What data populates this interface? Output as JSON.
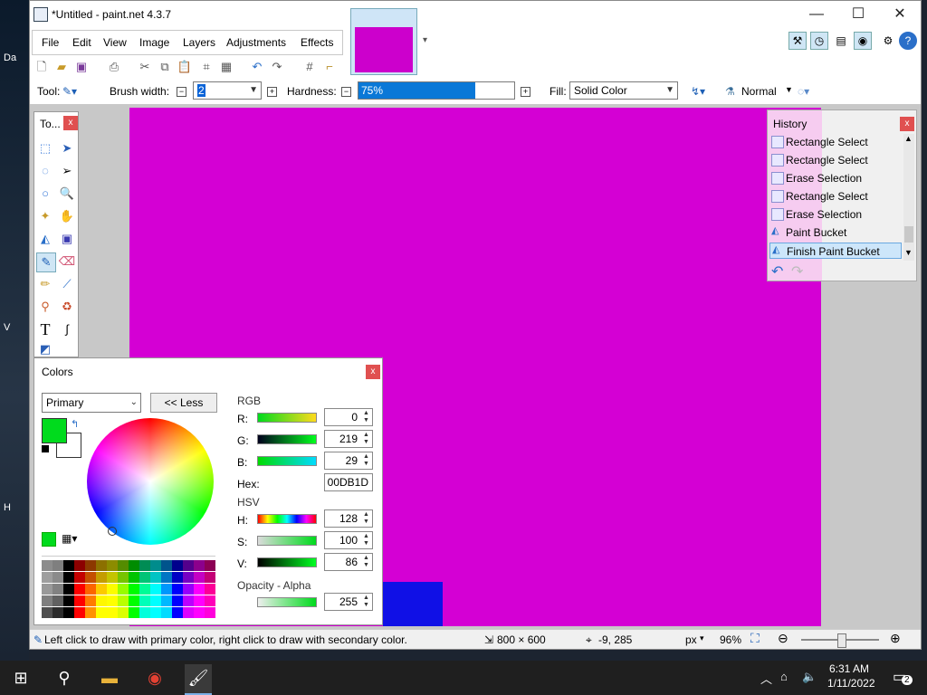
{
  "desktop": {
    "labels": [
      "Da",
      "V",
      "H"
    ]
  },
  "window": {
    "title": "*Untitled - paint.net 4.3.7",
    "controls": {
      "minimize": "—",
      "maximize": "☐",
      "close": "✕"
    }
  },
  "menu": [
    "File",
    "Edit",
    "View",
    "Image",
    "Layers",
    "Adjustments",
    "Effects"
  ],
  "tool_options": {
    "tool_label": "Tool:",
    "brush_width_label": "Brush width:",
    "brush_width_value": "2",
    "hardness_label": "Hardness:",
    "hardness_value": "75%",
    "hardness_fraction": 0.75,
    "fill_label": "Fill:",
    "fill_value": "Solid Color",
    "blend_value": "Normal"
  },
  "tools_panel": {
    "title": "To...",
    "close": "x"
  },
  "history": {
    "title": "History",
    "close": "x",
    "items": [
      "Rectangle Select",
      "Rectangle Select",
      "Erase Selection",
      "Rectangle Select",
      "Erase Selection",
      "Paint Bucket",
      "Finish Paint Bucket"
    ],
    "selected_index": 6
  },
  "colors": {
    "title": "Colors",
    "close": "x",
    "mode": "Primary",
    "less_button": "<< Less",
    "rgb_label": "RGB",
    "hsv_label": "HSV",
    "r_label": "R:",
    "r_value": "0",
    "g_label": "G:",
    "g_value": "219",
    "b_label": "B:",
    "b_value": "29",
    "hex_label": "Hex:",
    "hex_value": "00DB1D",
    "h_label": "H:",
    "h_value": "128",
    "s_label": "S:",
    "s_value": "100",
    "v_label": "V:",
    "v_value": "86",
    "opacity_label": "Opacity - Alpha",
    "opacity_value": "255",
    "primary_color": "#00DB1D",
    "secondary_color": "#FFFFFF"
  },
  "canvas": {
    "background": "#D400D4",
    "rect_color": "#1010E6"
  },
  "status": {
    "hint": "Left click to draw with primary color, right click to draw with secondary color.",
    "image_size": "800 × 600",
    "cursor": "-9, 285",
    "unit": "px",
    "zoom": "96%"
  },
  "taskbar": {
    "time": "6:31 AM",
    "date": "1/11/2022",
    "notifications": "2"
  }
}
